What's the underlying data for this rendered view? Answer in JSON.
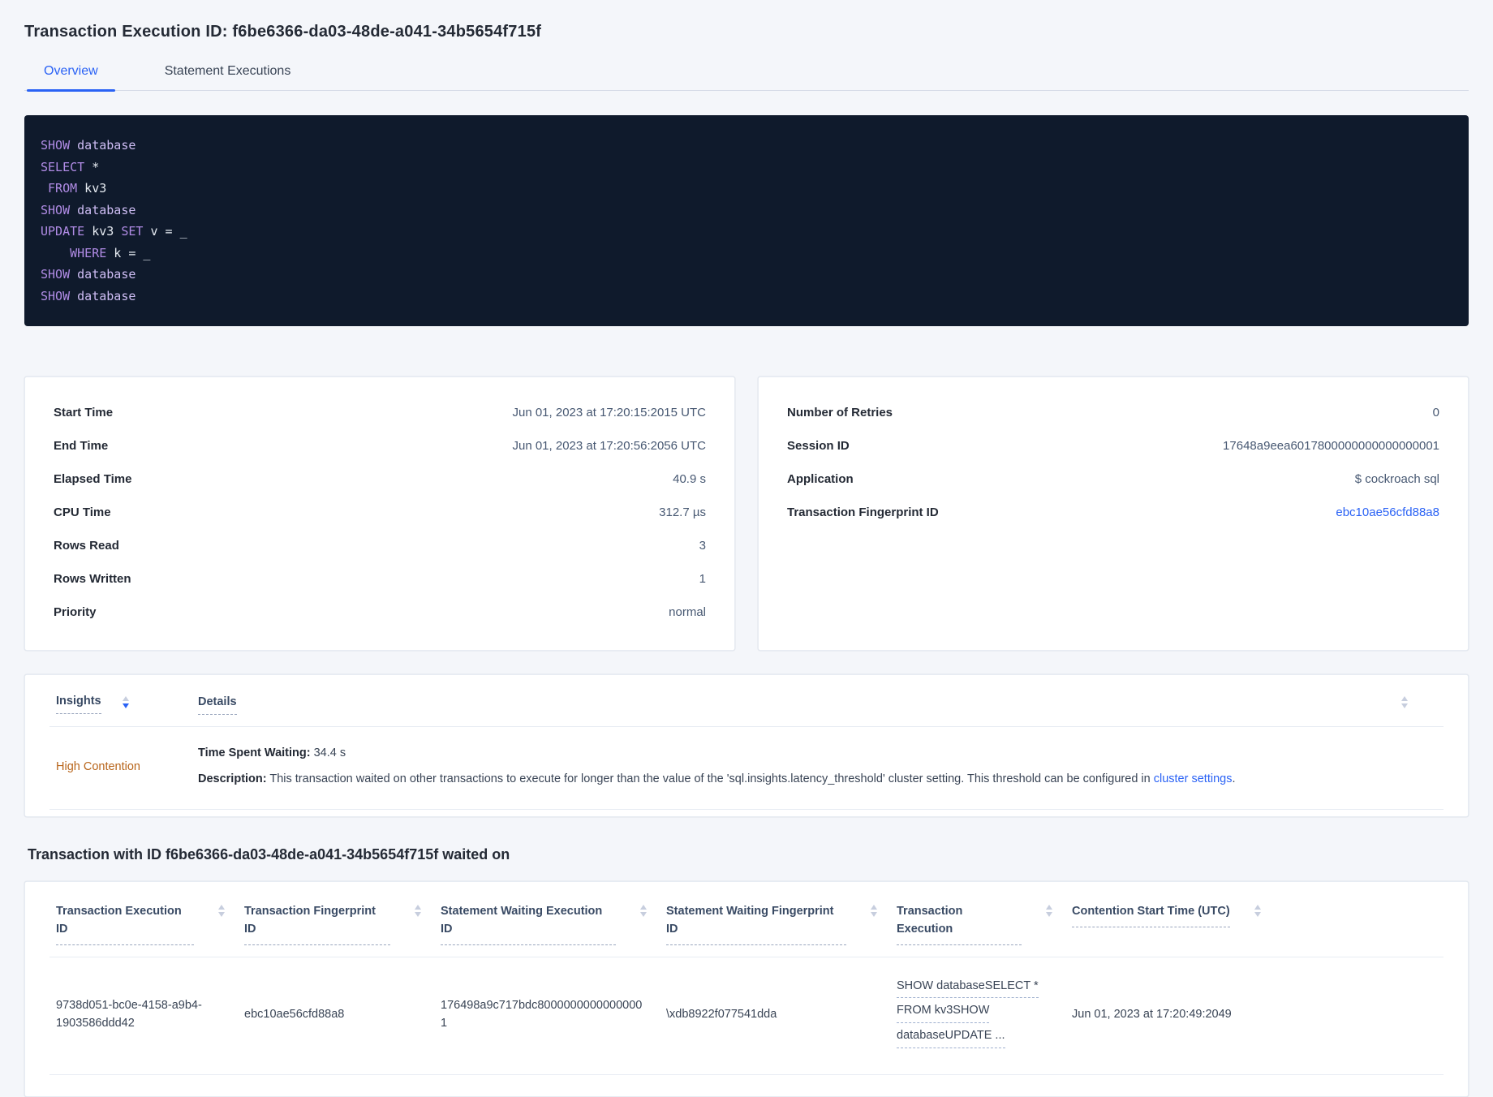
{
  "page": {
    "title": "Transaction Execution ID: f6be6366-da03-48de-a041-34b5654f715f"
  },
  "tabs": [
    {
      "label": "Overview",
      "active": true
    },
    {
      "label": "Statement Executions",
      "active": false
    }
  ],
  "sql": {
    "lines": [
      {
        "t0": "SHOW ",
        "t1": "database"
      },
      {
        "t0": "SELECT",
        "t1": " *"
      },
      {
        "t0": " ",
        "t1": "FROM",
        "t2": " kv3"
      },
      {
        "t0": "SHOW ",
        "t1": "database"
      },
      {
        "t0": "UPDATE",
        "t1": " kv3 ",
        "t2": "SET",
        "t3": " v = _"
      },
      {
        "t0": "    ",
        "t1": "WHERE",
        "t2": " k = _"
      },
      {
        "t0": "SHOW ",
        "t1": "database"
      },
      {
        "t0": "SHOW ",
        "t1": "database"
      }
    ]
  },
  "overview_card": {
    "rows": [
      {
        "label": "Start Time",
        "value": "Jun 01, 2023 at 17:20:15:2015 UTC"
      },
      {
        "label": "End Time",
        "value": "Jun 01, 2023 at 17:20:56:2056 UTC"
      },
      {
        "label": "Elapsed Time",
        "value": "40.9 s"
      },
      {
        "label": "CPU Time",
        "value": "312.7 µs"
      },
      {
        "label": "Rows Read",
        "value": "3"
      },
      {
        "label": "Rows Written",
        "value": "1"
      },
      {
        "label": "Priority",
        "value": "normal"
      }
    ]
  },
  "session_card": {
    "rows": [
      {
        "label": "Number of Retries",
        "value": "0"
      },
      {
        "label": "Session ID",
        "value": "17648a9eea6017800000000000000001"
      },
      {
        "label": "Application",
        "value": "$ cockroach sql"
      },
      {
        "label": "Transaction Fingerprint ID",
        "value": "ebc10ae56cfd88a8"
      }
    ]
  },
  "insights_table": {
    "columns": [
      "Insights",
      "Details"
    ],
    "sort": {
      "column": "Insights",
      "direction": "descending"
    },
    "row": {
      "insight": "High Contention",
      "waiting_label": "Time Spent Waiting:",
      "waiting_value": " 34.4 s",
      "description_label": "Description:",
      "description_text": " This transaction waited on other transactions to execute for longer than the value of the 'sql.insights.latency_threshold' cluster setting. This threshold can be configured in ",
      "description_link": "cluster settings",
      "description_end": "."
    }
  },
  "waited_on": {
    "heading": "Transaction with ID f6be6366-da03-48de-a041-34b5654f715f waited on",
    "columns": [
      "Transaction Execution ID",
      "Transaction Fingerprint ID",
      "Statement Waiting Execution ID",
      "Statement Waiting Fingerprint ID",
      "Transaction Execution",
      "Contention Start Time (UTC)"
    ],
    "row": {
      "txn_execution_id": "9738d051-bc0e-4158-a9b4-1903586ddd42",
      "txn_fingerprint_id": "ebc10ae56cfd88a8",
      "stmt_waiting_execution_id": "176498a9c717bdc80000000000000001",
      "stmt_waiting_fingerprint_id": "\\xdb8922f077541dda",
      "txn_execution_lines": [
        "SHOW databaseSELECT *",
        "FROM kv3SHOW",
        "databaseUPDATE ..."
      ],
      "contention_start_time": "Jun 01, 2023 at 17:20:49:2049"
    }
  },
  "icons": {
    "sort": "sort-arrows (triangle-up / triangle-down)"
  },
  "colors": {
    "accent_blue": "#2a62f5",
    "insight_orange": "#b8651b",
    "code_background": "#0f1a2c",
    "code_keyword": "#b18ce6",
    "code_identifier": "#cebdf4",
    "code_plain": "#e7ecf3",
    "page_background": "#f4f6fa"
  }
}
